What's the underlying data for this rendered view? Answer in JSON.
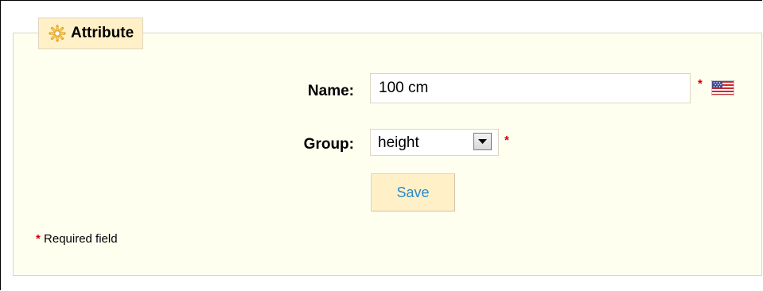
{
  "form": {
    "legend_title": "Attribute",
    "legend_icon": "asterisk-gear-icon",
    "name_label": "Name:",
    "name_value": "100 cm",
    "name_language": "us-flag-icon",
    "group_label": "Group:",
    "group_selected": "height",
    "required_marker": "*",
    "save_label": "Save",
    "required_note": "Required field"
  },
  "colors": {
    "panel_bg": "#fffff0",
    "legend_bg": "#fff0c8",
    "border": "#dfd5c3",
    "required_star": "#cc0000",
    "save_text": "#268ccd"
  }
}
